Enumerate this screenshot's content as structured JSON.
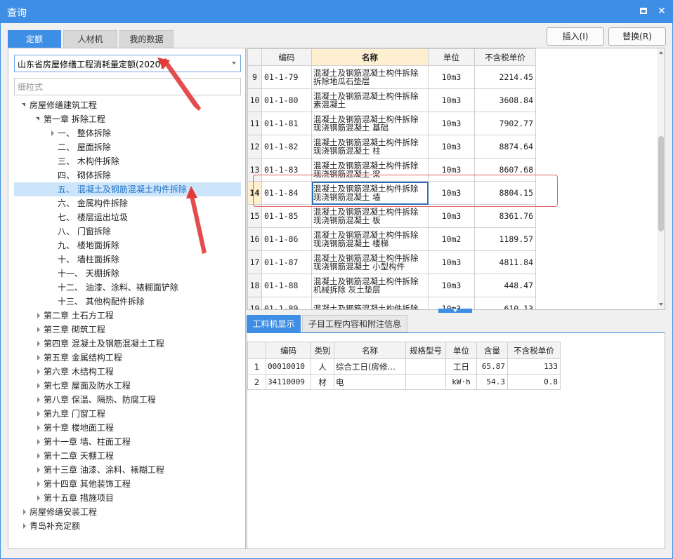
{
  "window": {
    "title": "查询"
  },
  "tabs": [
    {
      "label": "定额",
      "active": true
    },
    {
      "label": "人材机",
      "active": false
    },
    {
      "label": "我的数据",
      "active": false
    }
  ],
  "actions": {
    "insert_label": "插入(I)",
    "replace_label": "替换(R)"
  },
  "left": {
    "library_selected": "山东省房屋修缮工程消耗量定额(2020)",
    "search_placeholder": "细粒式",
    "tree": [
      {
        "label": "房屋修缮建筑工程",
        "level": 0,
        "toggle": "down"
      },
      {
        "label": "第一章 拆除工程",
        "level": 1,
        "toggle": "down"
      },
      {
        "label": "一、 整体拆除",
        "level": 2,
        "toggle": "right"
      },
      {
        "label": "二、 屋面拆除",
        "level": 2,
        "toggle": ""
      },
      {
        "label": "三、 木构件拆除",
        "level": 2,
        "toggle": ""
      },
      {
        "label": "四、 砌体拆除",
        "level": 2,
        "toggle": ""
      },
      {
        "label": "五、 混凝土及钢筋混凝土构件拆除",
        "level": 2,
        "toggle": "",
        "selected": true
      },
      {
        "label": "六、 金属构件拆除",
        "level": 2,
        "toggle": ""
      },
      {
        "label": "七、 楼层运出垃圾",
        "level": 2,
        "toggle": ""
      },
      {
        "label": "八、 门窗拆除",
        "level": 2,
        "toggle": ""
      },
      {
        "label": "九、 楼地面拆除",
        "level": 2,
        "toggle": ""
      },
      {
        "label": "十、 墙柱面拆除",
        "level": 2,
        "toggle": ""
      },
      {
        "label": "十一、 天棚拆除",
        "level": 2,
        "toggle": ""
      },
      {
        "label": "十二、 油漆、涂料、裱糊面铲除",
        "level": 2,
        "toggle": ""
      },
      {
        "label": "十三、 其他构配件拆除",
        "level": 2,
        "toggle": ""
      },
      {
        "label": "第二章 土石方工程",
        "level": 1,
        "toggle": "right"
      },
      {
        "label": "第三章 砌筑工程",
        "level": 1,
        "toggle": "right"
      },
      {
        "label": "第四章 混凝土及钢筋混凝土工程",
        "level": 1,
        "toggle": "right"
      },
      {
        "label": "第五章 金属结构工程",
        "level": 1,
        "toggle": "right"
      },
      {
        "label": "第六章 木结构工程",
        "level": 1,
        "toggle": "right"
      },
      {
        "label": "第七章 屋面及防水工程",
        "level": 1,
        "toggle": "right"
      },
      {
        "label": "第八章 保温、隔热、防腐工程",
        "level": 1,
        "toggle": "right"
      },
      {
        "label": "第九章 门窗工程",
        "level": 1,
        "toggle": "right"
      },
      {
        "label": "第十章 楼地面工程",
        "level": 1,
        "toggle": "right"
      },
      {
        "label": "第十一章 墙、柱面工程",
        "level": 1,
        "toggle": "right"
      },
      {
        "label": "第十二章 天棚工程",
        "level": 1,
        "toggle": "right"
      },
      {
        "label": "第十三章 油漆、涂料、裱糊工程",
        "level": 1,
        "toggle": "right"
      },
      {
        "label": "第十四章 其他装饰工程",
        "level": 1,
        "toggle": "right"
      },
      {
        "label": "第十五章 措施项目",
        "level": 1,
        "toggle": "right"
      },
      {
        "label": "房屋修缮安装工程",
        "level": 0,
        "toggle": "right"
      },
      {
        "label": "青岛补充定额",
        "level": 0,
        "toggle": "right"
      }
    ]
  },
  "quota_table": {
    "headers": [
      "",
      "编码",
      "名称",
      "单位",
      "不含税单价"
    ],
    "rows": [
      {
        "no": "9",
        "code": "01-1-79",
        "name1": "混凝土及钢筋混凝土构件拆除",
        "name2": "拆除地瓜石垫层",
        "unit": "10m3",
        "price": "2214.45"
      },
      {
        "no": "10",
        "code": "01-1-80",
        "name1": "混凝土及钢筋混凝土构件拆除",
        "name2": "素混凝土",
        "unit": "10m3",
        "price": "3608.84"
      },
      {
        "no": "11",
        "code": "01-1-81",
        "name1": "混凝土及钢筋混凝土构件拆除",
        "name2": "现浇钢筋混凝土 基础",
        "unit": "10m3",
        "price": "7902.77"
      },
      {
        "no": "12",
        "code": "01-1-82",
        "name1": "混凝土及钢筋混凝土构件拆除",
        "name2": "现浇钢筋混凝土 柱",
        "unit": "10m3",
        "price": "8874.64"
      },
      {
        "no": "13",
        "code": "01-1-83",
        "name1": "混凝土及钢筋混凝土构件拆除",
        "name2": "现浇钢筋混凝土 梁",
        "unit": "10m3",
        "price": "8607.68"
      },
      {
        "no": "14",
        "code": "01-1-84",
        "name1": "混凝土及钢筋混凝土构件拆除",
        "name2": "现浇钢筋混凝土 墙",
        "unit": "10m3",
        "price": "8804.15",
        "current": true
      },
      {
        "no": "15",
        "code": "01-1-85",
        "name1": "混凝土及钢筋混凝土构件拆除",
        "name2": "现浇钢筋混凝土 板",
        "unit": "10m3",
        "price": "8361.76"
      },
      {
        "no": "16",
        "code": "01-1-86",
        "name1": "混凝土及钢筋混凝土构件拆除",
        "name2": "现浇钢筋混凝土 楼梯",
        "unit": "10m2",
        "price": "1189.57"
      },
      {
        "no": "17",
        "code": "01-1-87",
        "name1": "混凝土及钢筋混凝土构件拆除",
        "name2": "现浇钢筋混凝土 小型构件",
        "unit": "10m3",
        "price": "4811.84"
      },
      {
        "no": "18",
        "code": "01-1-88",
        "name1": "混凝土及钢筋混凝土构件拆除",
        "name2": "机械拆除 灰土垫层",
        "unit": "10m3",
        "price": "448.47"
      },
      {
        "no": "19",
        "code": "01-1-89",
        "name1": "混凝土及钢筋混凝土构件拆除",
        "name2": "",
        "unit": "10m3",
        "price": "610.13"
      }
    ]
  },
  "bottom_tabs": [
    {
      "label": "工料机显示",
      "active": true
    },
    {
      "label": "子目工程内容和附注信息",
      "active": false
    }
  ],
  "material_table": {
    "headers": [
      "",
      "编码",
      "类别",
      "名称",
      "规格型号",
      "单位",
      "含量",
      "不含税单价"
    ],
    "rows": [
      {
        "no": "1",
        "code": "00010010",
        "type": "人",
        "name": "综合工日(房修…",
        "spec": "",
        "unit": "工日",
        "qty": "65.87",
        "price": "133"
      },
      {
        "no": "2",
        "code": "34110009",
        "type": "材",
        "name": "电",
        "spec": "",
        "unit": "kW·h",
        "qty": "54.3",
        "price": "0.8"
      }
    ]
  },
  "colors": {
    "accent": "#3f8ee5",
    "selection": "#cde5fb",
    "header_highlight": "#fdefcf",
    "annotation": "#e03a3a"
  }
}
